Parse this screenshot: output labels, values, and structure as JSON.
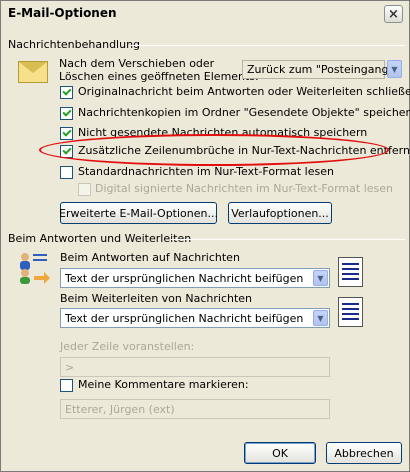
{
  "window": {
    "title": "E-Mail-Optionen",
    "close_symbol": "×"
  },
  "section_message_handling": {
    "heading": "Nachrichtenbehandlung",
    "after_move_label_line1": "Nach dem Verschieben oder",
    "after_move_label_line2": "Löschen eines geöffneten Elements:",
    "after_move_value": "Zurück zum \"Posteingang\"",
    "options": [
      {
        "label": "Originalnachricht beim Antworten oder Weiterleiten schließen",
        "checked": true
      },
      {
        "label": "Nachrichtenkopien im Ordner \"Gesendete Objekte\" speichern",
        "checked": true
      },
      {
        "label": "Nicht gesendete Nachrichten automatisch speichern",
        "checked": true
      },
      {
        "label": "Zusätzliche Zeilenumbrüche in Nur-Text-Nachrichten entfernen",
        "checked": true
      },
      {
        "label": "Standardnachrichten im Nur-Text-Format lesen",
        "checked": false
      },
      {
        "label": "Digital signierte Nachrichten im Nur-Text-Format lesen",
        "checked": false,
        "disabled": true
      }
    ],
    "advanced_button": "Erweiterte E-Mail-Optionen...",
    "tracking_button": "Verlaufoptionen..."
  },
  "section_reply_forward": {
    "heading": "Beim Antworten und Weiterleiten",
    "reply_label": "Beim Antworten auf Nachrichten",
    "reply_value": "Text der ursprünglichen Nachricht beifügen",
    "forward_label": "Beim Weiterleiten von Nachrichten",
    "forward_value": "Text der ursprünglichen Nachricht beifügen",
    "prefix_label": "Jeder Zeile voranstellen:",
    "prefix_value": ">",
    "mark_comments_label": "Meine Kommentare markieren:",
    "mark_comments_checked": false,
    "comment_name_value": "Etterer, Jürgen (ext)"
  },
  "footer": {
    "ok_label": "OK",
    "cancel_label": "Abbrechen"
  },
  "colors": {
    "highlight": "#e30f0f",
    "window_bg": "#ece9d8"
  }
}
